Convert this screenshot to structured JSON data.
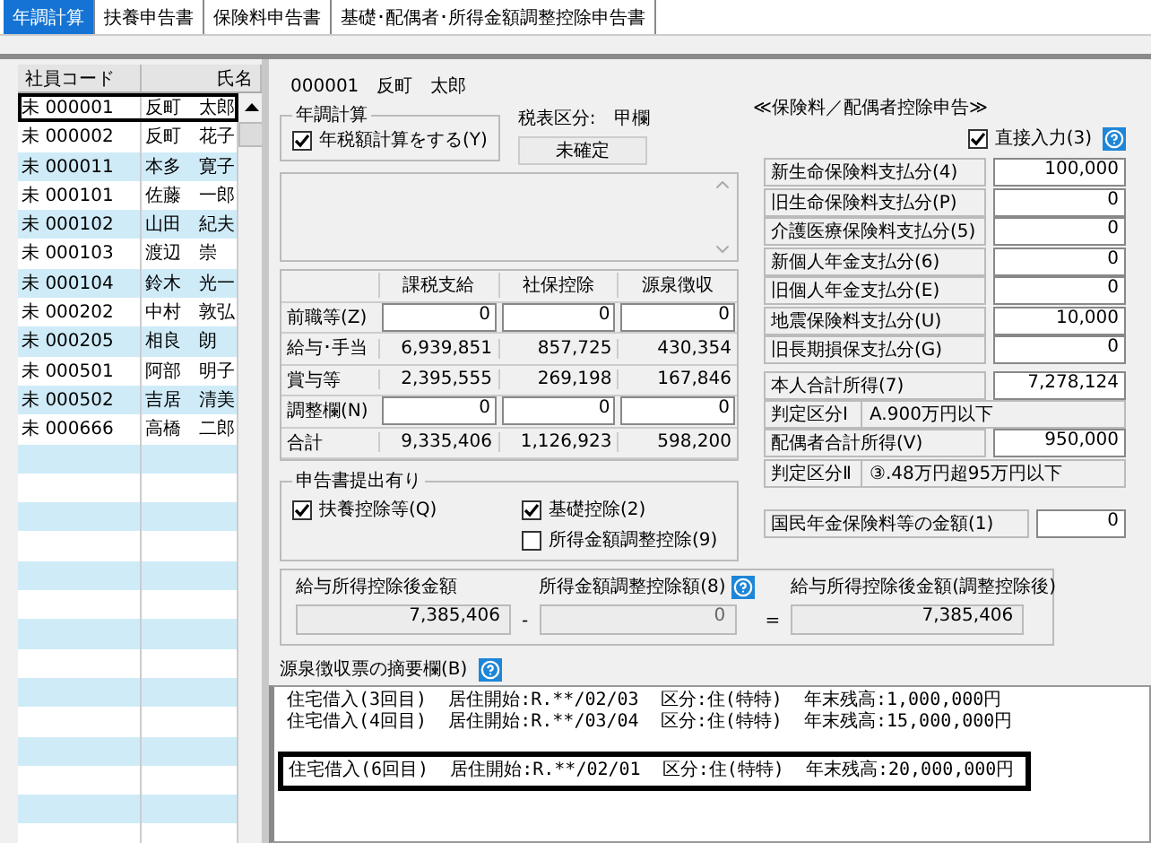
{
  "tabs": [
    {
      "label": "年調計算",
      "selected": true
    },
    {
      "label": "扶養申告書",
      "selected": false
    },
    {
      "label": "保険料申告書",
      "selected": false
    },
    {
      "label": "基礎･配偶者･所得金額調整控除申告書",
      "selected": false
    }
  ],
  "employee_list": {
    "columns": [
      "社員コード",
      "氏名"
    ],
    "rows": [
      {
        "status": "未",
        "code": "000001",
        "name": "反町　太郎",
        "selected": true
      },
      {
        "status": "未",
        "code": "000002",
        "name": "反町　花子",
        "selected": false
      },
      {
        "status": "未",
        "code": "000011",
        "name": "本多　寛子",
        "selected": false
      },
      {
        "status": "未",
        "code": "000101",
        "name": "佐藤　一郎",
        "selected": false
      },
      {
        "status": "未",
        "code": "000102",
        "name": "山田　紀夫",
        "selected": false
      },
      {
        "status": "未",
        "code": "000103",
        "name": "渡辺　崇",
        "selected": false
      },
      {
        "status": "未",
        "code": "000104",
        "name": "鈴木　光一",
        "selected": false
      },
      {
        "status": "未",
        "code": "000202",
        "name": "中村　敦弘",
        "selected": false
      },
      {
        "status": "未",
        "code": "000205",
        "name": "相良　朗",
        "selected": false
      },
      {
        "status": "未",
        "code": "000501",
        "name": "阿部　明子",
        "selected": false
      },
      {
        "status": "未",
        "code": "000502",
        "name": "吉居　清美",
        "selected": false
      },
      {
        "status": "未",
        "code": "000666",
        "name": "高橋　二郎",
        "selected": false
      }
    ]
  },
  "employee": {
    "code": "000001",
    "name": "反町　太郎"
  },
  "year_end_group": {
    "title": "年調計算",
    "checkbox": {
      "label": "年税額計算をする(Y)",
      "checked": true
    }
  },
  "tax_table": {
    "label": "税表区分:",
    "value": "甲欄",
    "status": "未確定"
  },
  "income_table": {
    "columns": [
      "課税支給",
      "社保控除",
      "源泉徴収"
    ],
    "rows": [
      {
        "label": "前職等(Z)",
        "kind": "input",
        "values": [
          "0",
          "0",
          "0"
        ]
      },
      {
        "label": "給与･手当",
        "kind": "display",
        "values": [
          "6,939,851",
          "857,725",
          "430,354"
        ]
      },
      {
        "label": "賞与等",
        "kind": "display",
        "values": [
          "2,395,555",
          "269,198",
          "167,846"
        ]
      },
      {
        "label": "調整欄(N)",
        "kind": "input",
        "values": [
          "0",
          "0",
          "0"
        ]
      },
      {
        "label": "合計",
        "kind": "display",
        "values": [
          "9,335,406",
          "1,126,923",
          "598,200"
        ]
      }
    ]
  },
  "declaration_group": {
    "title": "申告書提出有り",
    "options": [
      {
        "label": "扶養控除等(Q)",
        "checked": true
      },
      {
        "label": "基礎控除(2)",
        "checked": true
      },
      {
        "label": "所得金額調整控除(9)",
        "checked": false
      }
    ]
  },
  "salary_calc": {
    "after_deduction": {
      "label": "給与所得控除後金額",
      "value": "7,385,406"
    },
    "minus": "-",
    "adjustment": {
      "label": "所得金額調整控除額(8)",
      "value": "0"
    },
    "equals": "=",
    "result": {
      "label": "給与所得控除後金額(調整控除後)",
      "value": "7,385,406"
    }
  },
  "insurance": {
    "title": "≪保険料／配偶者控除申告≫",
    "direct_input": {
      "label": "直接入力(3)",
      "checked": true
    },
    "rows": [
      {
        "label": "新生命保険料支払分(4)",
        "value": "100,000"
      },
      {
        "label": "旧生命保険料支払分(P)",
        "value": "0"
      },
      {
        "label": "介護医療保険料支払分(5)",
        "value": "0"
      },
      {
        "label": "新個人年金支払分(6)",
        "value": "0"
      },
      {
        "label": "旧個人年金支払分(E)",
        "value": "0"
      },
      {
        "label": "地震保険料支払分(U)",
        "value": "10,000"
      },
      {
        "label": "旧長期損保支払分(G)",
        "value": "0"
      }
    ],
    "own_income": {
      "label": "本人合計所得(7)",
      "value": "7,278,124"
    },
    "class1": {
      "label": "判定区分Ⅰ",
      "value": "A.900万円以下"
    },
    "spouse_income": {
      "label": "配偶者合計所得(V)",
      "value": "950,000"
    },
    "class2": {
      "label": "判定区分Ⅱ",
      "value": "③.48万円超95万円以下"
    },
    "pension": {
      "label": "国民年金保険料等の金額(1)",
      "value": "0"
    }
  },
  "memo": {
    "label": "源泉徴収票の摘要欄(B)",
    "lines": [
      {
        "text": "住宅借入(3回目)  居住開始:R.**/02/03  区分:住(特特)  年末残高:1,000,000円",
        "highlighted": false
      },
      {
        "text": "住宅借入(4回目)  居住開始:R.**/03/04  区分:住(特特)  年末残高:15,000,000円",
        "highlighted": false
      },
      {
        "text": "住宅借入(6回目)  居住開始:R.**/02/01  区分:住(特特)  年末残高:20,000,000円",
        "highlighted": true
      }
    ]
  }
}
